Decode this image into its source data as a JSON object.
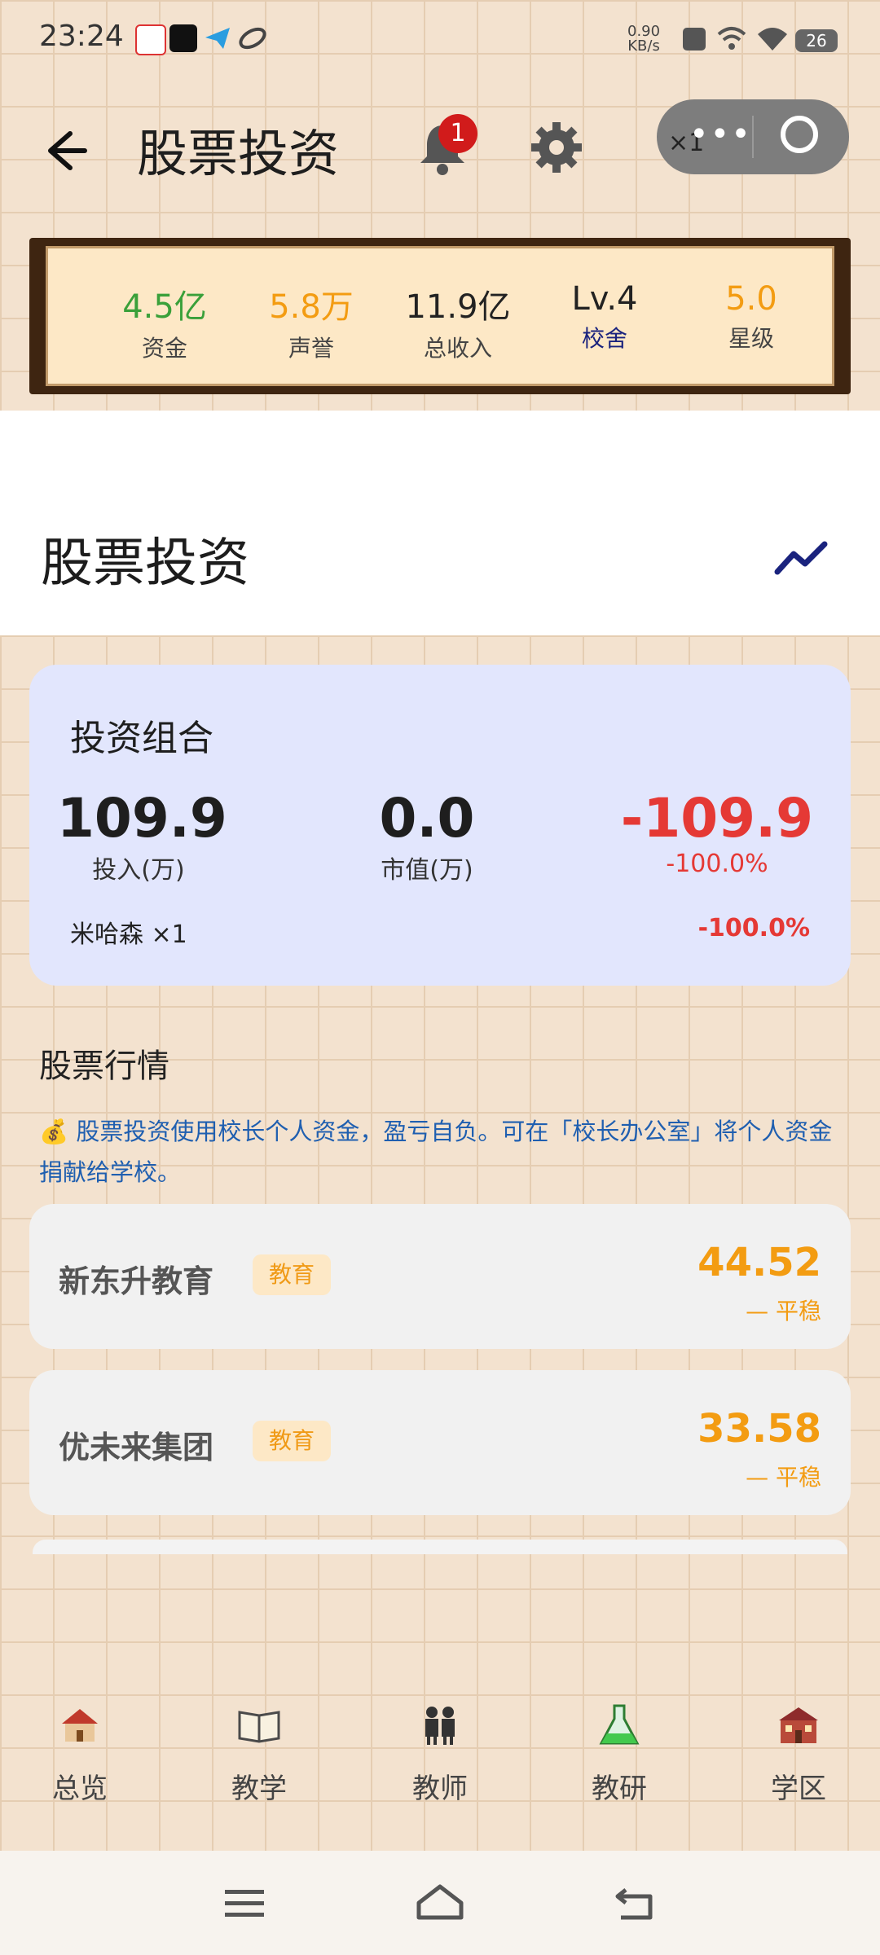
{
  "status_bar": {
    "time": "23:24",
    "speed_value": "0.90",
    "speed_unit": "KB/s",
    "battery": "26",
    "icons": [
      "app-icon",
      "tiktok-icon",
      "telegram-icon",
      "app-icon",
      "sim-x-icon",
      "wifi-6-icon",
      "wifi-icon",
      "battery-icon"
    ]
  },
  "header": {
    "title": "股票投资",
    "notification_count": "1",
    "capsule_multiplier": "×1"
  },
  "stats": [
    {
      "value": "4.5亿",
      "label": "资金",
      "value_color": "#3aa03a",
      "label_color": "#444444"
    },
    {
      "value": "5.8万",
      "label": "声誉",
      "value_color": "#f39c12",
      "label_color": "#444444"
    },
    {
      "value": "11.9亿",
      "label": "总收入",
      "value_color": "#222222",
      "label_color": "#444444"
    },
    {
      "value": "Lv.4",
      "label": "校舍",
      "value_color": "#222222",
      "label_color": "#1a237e"
    },
    {
      "value": "5.0",
      "label": "星级",
      "value_color": "#f39c12",
      "label_color": "#444444"
    }
  ],
  "page": {
    "title": "股票投资"
  },
  "portfolio": {
    "title": "投资组合",
    "invested_value": "109.9",
    "invested_label": "投入(万)",
    "market_value": "0.0",
    "market_label": "市值(万)",
    "pnl_value": "-109.9",
    "pnl_percent": "-100.0%",
    "holding_name": "米哈森 ×1",
    "holding_percent": "-100.0%",
    "loss_color": "#e53935"
  },
  "market": {
    "title": "股票行情",
    "notice": "💰 股票投资使用校长个人资金，盈亏自负。可在「校长办公室」将个人资金捐献给学校。",
    "stocks": [
      {
        "name": "新东升教育",
        "tag": "教育",
        "price": "44.52",
        "trend": "— 平稳"
      },
      {
        "name": "优未来集团",
        "tag": "教育",
        "price": "33.58",
        "trend": "— 平稳"
      }
    ]
  },
  "bottom_nav": [
    {
      "label": "总览",
      "icon": "school-house-icon"
    },
    {
      "label": "教学",
      "icon": "open-book-icon"
    },
    {
      "label": "教师",
      "icon": "teachers-icon"
    },
    {
      "label": "教研",
      "icon": "flask-icon"
    },
    {
      "label": "学区",
      "icon": "school-building-icon"
    }
  ]
}
